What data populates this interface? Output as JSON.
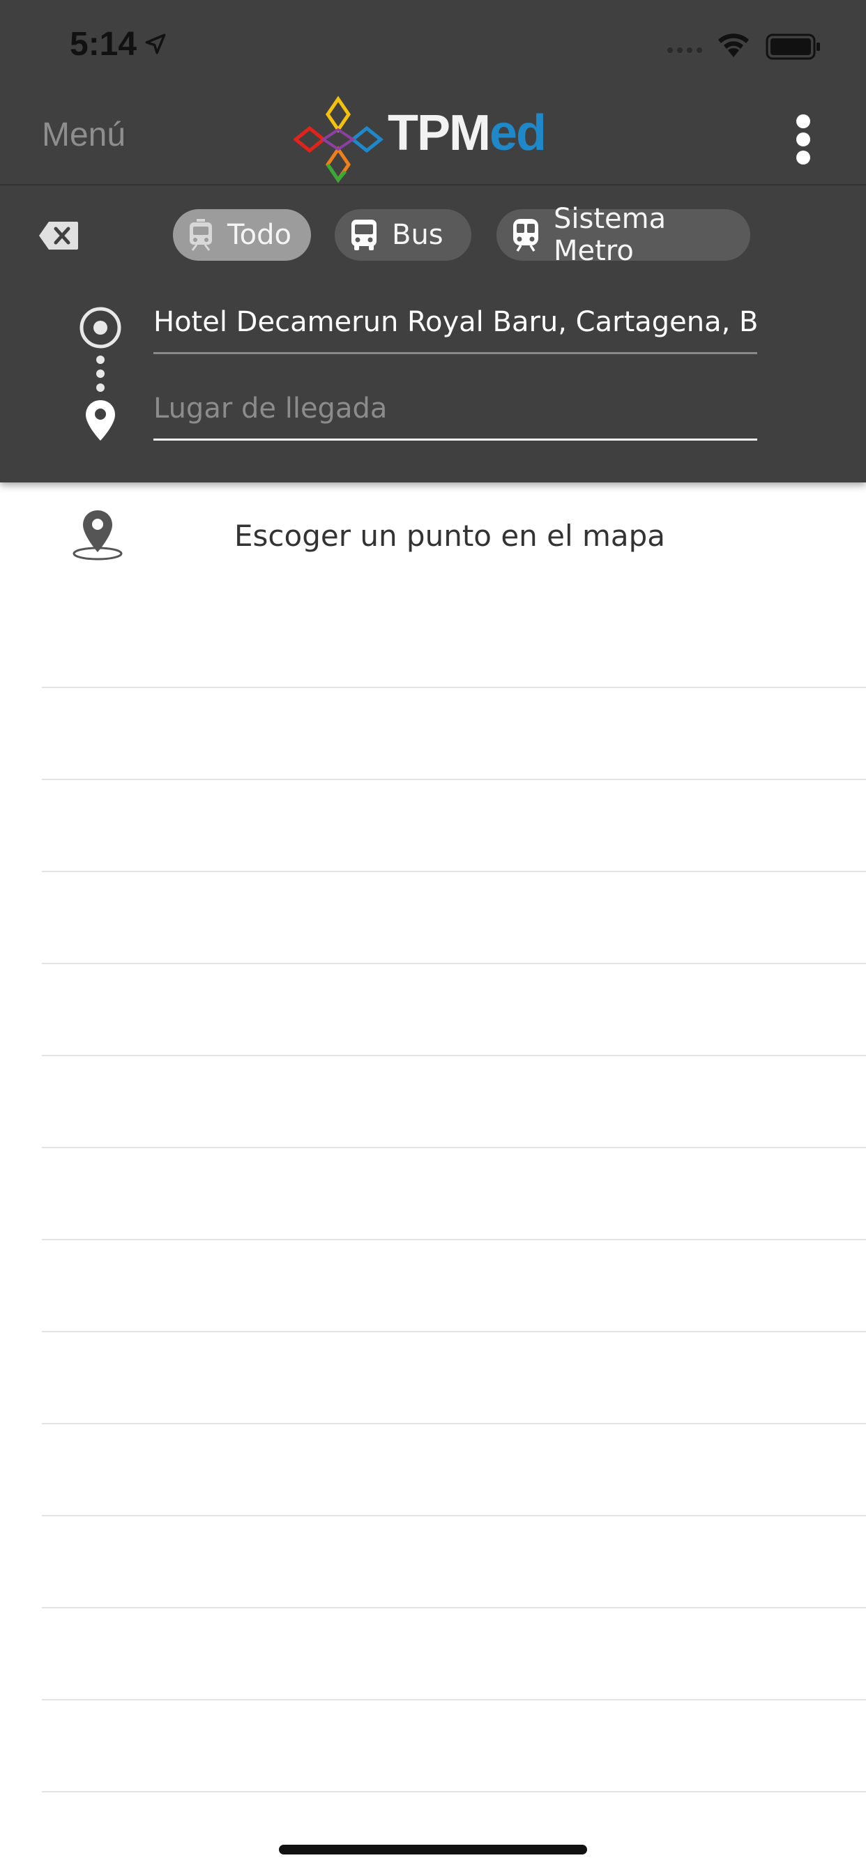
{
  "status_bar": {
    "time": "5:14"
  },
  "nav": {
    "menu_label": "Menú",
    "logo_text_primary": "TPM",
    "logo_text_accent": "ed"
  },
  "modes": [
    {
      "label": "Todo",
      "icon": "tram-icon",
      "selected": true
    },
    {
      "label": "Bus",
      "icon": "bus-icon",
      "selected": false
    },
    {
      "label": "Sistema Metro",
      "icon": "metro-icon",
      "selected": false
    }
  ],
  "route": {
    "origin_value": "Hotel Decamerun Royal Baru, Cartagena, B...",
    "destination_placeholder": "Lugar de llegada",
    "destination_value": ""
  },
  "suggestions": {
    "map_pick_label": "Escoger un punto en el mapa"
  },
  "colors": {
    "header_bg": "#404040",
    "chip_bg": "#5a5a5a",
    "chip_selected_bg": "#9c9c9c",
    "logo_accent": "#1e88c8"
  }
}
